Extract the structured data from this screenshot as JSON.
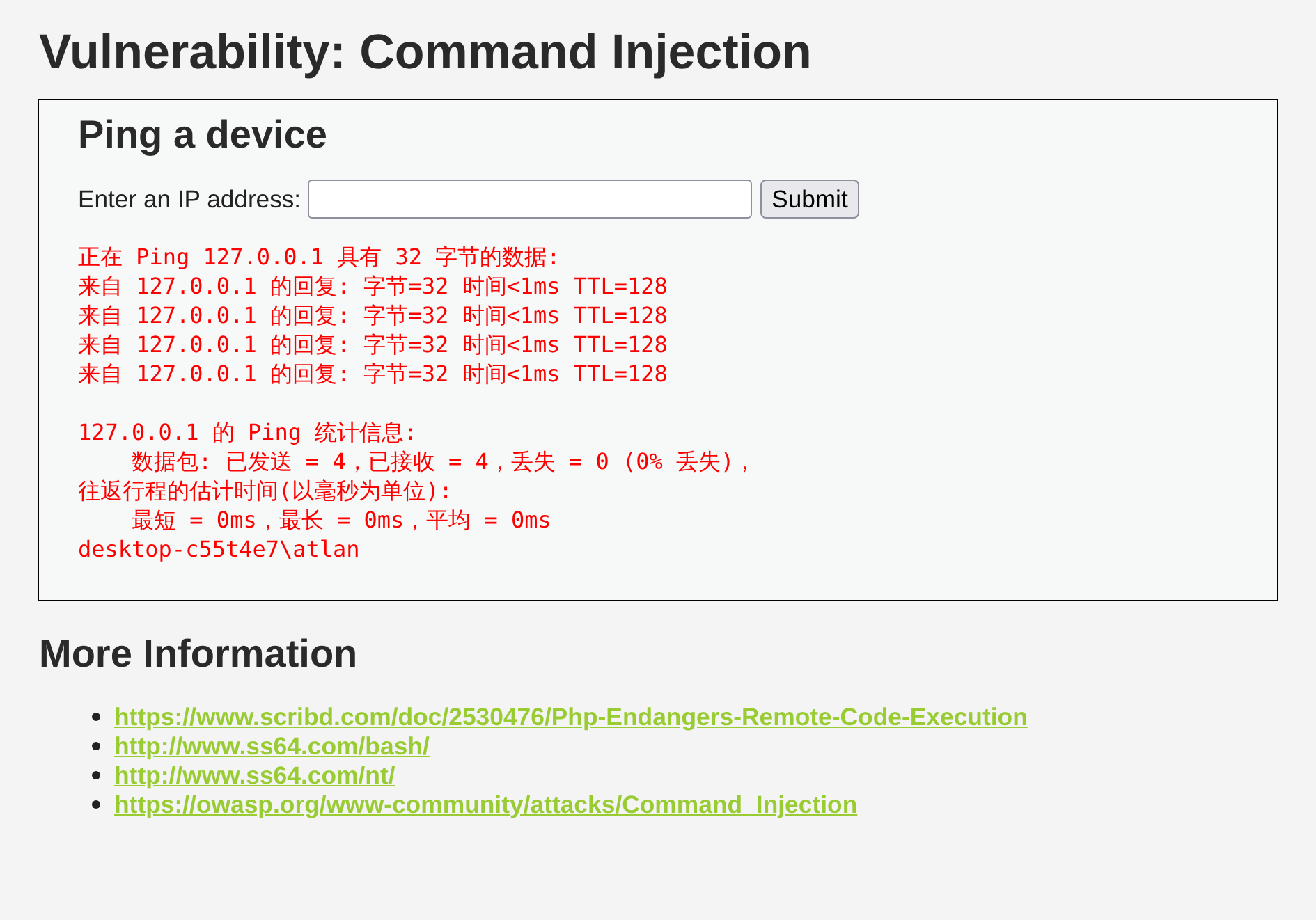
{
  "page": {
    "title": "Vulnerability: Command Injection"
  },
  "panel": {
    "title": "Ping a device",
    "form": {
      "label": "Enter an IP address:",
      "submit": "Submit"
    },
    "output": {
      "blocks": [
        [
          "正在 Ping 127.0.0.1 具有 32 字节的数据:",
          "来自 127.0.0.1 的回复: 字节=32 时间<1ms TTL=128",
          "来自 127.0.0.1 的回复: 字节=32 时间<1ms TTL=128",
          "来自 127.0.0.1 的回复: 字节=32 时间<1ms TTL=128",
          "来自 127.0.0.1 的回复: 字节=32 时间<1ms TTL=128"
        ],
        [
          "127.0.0.1 的 Ping 统计信息:",
          "    数据包: 已发送 = 4，已接收 = 4，丢失 = 0 (0% 丢失)，",
          "往返行程的估计时间(以毫秒为单位):",
          "    最短 = 0ms，最长 = 0ms，平均 = 0ms",
          "desktop-c55t4e7\\atlan"
        ]
      ]
    }
  },
  "more_info": {
    "title": "More Information",
    "links": [
      "https://www.scribd.com/doc/2530476/Php-Endangers-Remote-Code-Execution",
      "http://www.ss64.com/bash/",
      "http://www.ss64.com/nt/",
      "https://owasp.org/www-community/attacks/Command_Injection"
    ]
  }
}
